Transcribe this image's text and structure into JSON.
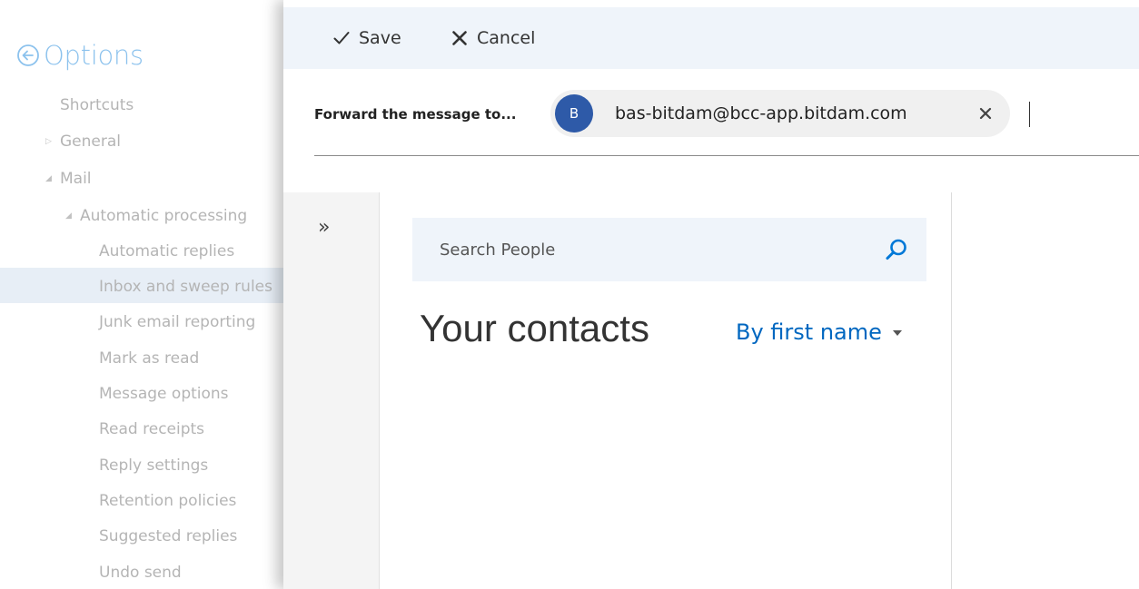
{
  "options_nav": {
    "title": "Options",
    "items": [
      {
        "label": "Shortcuts",
        "level": 1,
        "toggle": ""
      },
      {
        "label": "General",
        "level": 1,
        "toggle": "collapsed"
      },
      {
        "label": "Mail",
        "level": 1,
        "toggle": "expanded"
      },
      {
        "label": "Automatic processing",
        "level": 2,
        "toggle": "expanded"
      },
      {
        "label": "Automatic replies",
        "level": 3,
        "toggle": ""
      },
      {
        "label": "Inbox and sweep rules",
        "level": 3,
        "toggle": "",
        "selected": true
      },
      {
        "label": "Junk email reporting",
        "level": 3,
        "toggle": ""
      },
      {
        "label": "Mark as read",
        "level": 3,
        "toggle": ""
      },
      {
        "label": "Message options",
        "level": 3,
        "toggle": ""
      },
      {
        "label": "Read receipts",
        "level": 3,
        "toggle": ""
      },
      {
        "label": "Reply settings",
        "level": 3,
        "toggle": ""
      },
      {
        "label": "Retention policies",
        "level": 3,
        "toggle": ""
      },
      {
        "label": "Suggested replies",
        "level": 3,
        "toggle": ""
      },
      {
        "label": "Undo send",
        "level": 3,
        "toggle": ""
      }
    ]
  },
  "toolbar": {
    "save_label": "Save",
    "cancel_label": "Cancel"
  },
  "forward": {
    "label": "Forward the message to...",
    "recipient": {
      "initial": "B",
      "email": "bas-bitdam@bcc-app.bitdam.com"
    }
  },
  "people_picker": {
    "expand_glyph": "»",
    "search_placeholder": "Search People",
    "heading": "Your contacts",
    "sort_label": "By first name"
  },
  "colors": {
    "accent": "#0078d7",
    "avatar": "#2e5aa8",
    "toolbar_bg": "#eff4fa",
    "selected_bg": "#c9d9ec"
  }
}
